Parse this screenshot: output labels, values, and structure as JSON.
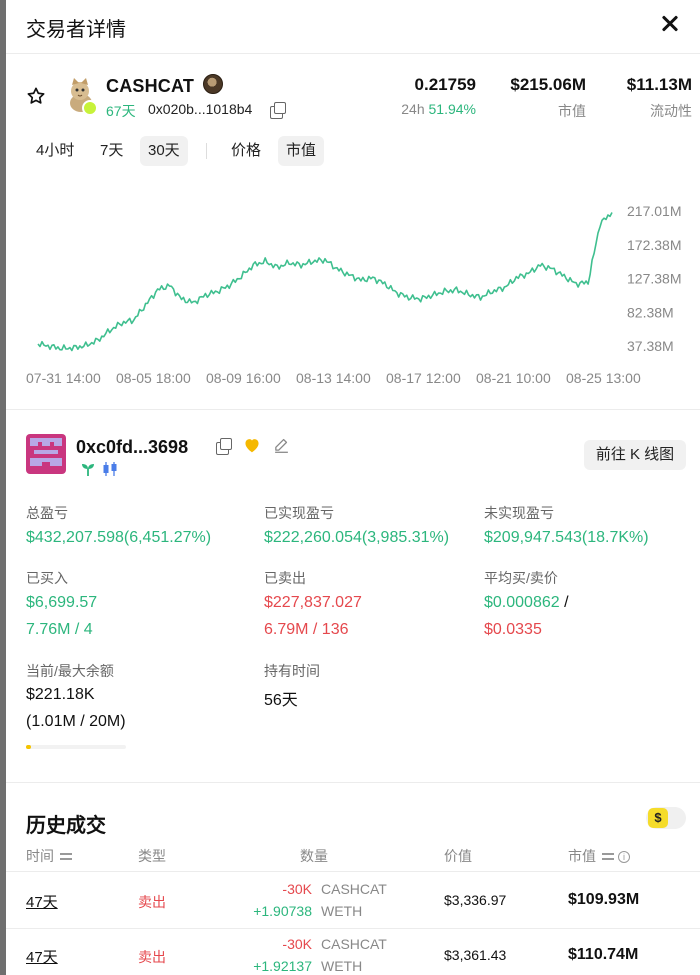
{
  "header": {
    "title": "交易者详情"
  },
  "token": {
    "name": "CASHCAT",
    "age": "67天",
    "address": "0x020b...1018b4",
    "price": "0.21759",
    "change_label": "24h",
    "change_value": "51.94%",
    "market_cap": "$215.06M",
    "market_cap_label": "市值",
    "liquidity": "$11.13M",
    "liquidity_label": "流动性"
  },
  "tabs": {
    "ranges": [
      "4小时",
      "7天",
      "30天"
    ],
    "active_range": "30天",
    "modes": [
      "价格",
      "市值"
    ],
    "active_mode": "市值"
  },
  "chart_data": {
    "type": "line",
    "x_tick_labels": [
      "07-31 14:00",
      "08-05 18:00",
      "08-09 16:00",
      "08-13 14:00",
      "08-17 12:00",
      "08-21 10:00",
      "08-25 13:00"
    ],
    "y_tick_labels": [
      "217.01M",
      "172.38M",
      "127.38M",
      "82.38M",
      "37.38M"
    ],
    "ylim": [
      37.38,
      217.01
    ],
    "line_color": "#3fbf8f",
    "series": [
      {
        "values": [
          40,
          37,
          34,
          35,
          38,
          45,
          58,
          68,
          72,
          92,
          112,
          118,
          100,
          95,
          105,
          110,
          118,
          130,
          145,
          150,
          142,
          148,
          145,
          150,
          152,
          140,
          132,
          125,
          128,
          120,
          108,
          102,
          100,
          105,
          110,
          112,
          106,
          102,
          110,
          115,
          128,
          134,
          145,
          140,
          130,
          120,
          122,
          200,
          215
        ]
      }
    ]
  },
  "trader": {
    "address": "0xc0fd...3698",
    "kline_button": "前往 K 线图"
  },
  "metrics": {
    "total_pnl_label": "总盈亏",
    "total_pnl": "$432,207.598(6,451.27%)",
    "realized_label": "已实现盈亏",
    "realized": "$222,260.054(3,985.31%)",
    "unrealized_label": "未实现盈亏",
    "unrealized": "$209,947.543(18.7K%)",
    "bought_label": "已买入",
    "bought_usd": "$6,699.57",
    "bought_qty": "7.76M / 4",
    "sold_label": "已卖出",
    "sold_usd": "$227,837.027",
    "sold_qty": "6.79M / 136",
    "avg_label": "平均买/卖价",
    "avg_buy": "$0.000862",
    "avg_sep": " /",
    "avg_sell": "$0.0335",
    "balance_label": "当前/最大余额",
    "balance": "$221.18K",
    "balance_sub": "(1.01M / 20M)",
    "balance_fraction": 0.05,
    "hold_label": "持有时间",
    "hold": "56天"
  },
  "history": {
    "title": "历史成交",
    "toggle_symbol": "$",
    "columns": {
      "time": "时间",
      "type": "类型",
      "qty": "数量",
      "value": "价值",
      "mcap": "市值"
    },
    "rows": [
      {
        "time": "47天",
        "type": "卖出",
        "qty_out": "-30K",
        "tok_out": "CASHCAT",
        "qty_in": "+1.90738",
        "tok_in": "WETH",
        "value": "$3,336.97",
        "mcap": "$109.93M"
      },
      {
        "time": "47天",
        "type": "卖出",
        "qty_out": "-30K",
        "tok_out": "CASHCAT",
        "qty_in": "+1.92137",
        "tok_in": "WETH",
        "value": "$3,361.43",
        "mcap": "$110.74M"
      }
    ]
  },
  "colors": {
    "green": "#2cb67d",
    "red": "#e5484d",
    "accent_yellow": "#f5c400"
  }
}
